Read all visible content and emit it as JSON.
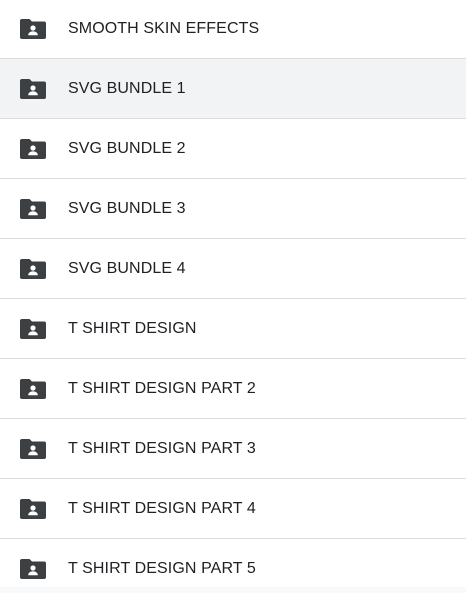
{
  "folders": [
    {
      "name": "SMOOTH SKIN EFFECTS",
      "icon": "shared-folder-icon",
      "selected": false
    },
    {
      "name": "SVG BUNDLE 1",
      "icon": "shared-folder-icon",
      "selected": true
    },
    {
      "name": "SVG BUNDLE 2",
      "icon": "shared-folder-icon",
      "selected": false
    },
    {
      "name": "SVG BUNDLE 3",
      "icon": "shared-folder-icon",
      "selected": false
    },
    {
      "name": "SVG BUNDLE 4",
      "icon": "shared-folder-icon",
      "selected": false
    },
    {
      "name": "T SHIRT DESIGN",
      "icon": "shared-folder-icon",
      "selected": false
    },
    {
      "name": "T SHIRT DESIGN PART 2",
      "icon": "shared-folder-icon",
      "selected": false
    },
    {
      "name": "T SHIRT DESIGN PART 3",
      "icon": "shared-folder-icon",
      "selected": false
    },
    {
      "name": "T SHIRT DESIGN PART 4",
      "icon": "shared-folder-icon",
      "selected": false
    },
    {
      "name": "T SHIRT DESIGN PART 5",
      "icon": "shared-folder-icon",
      "selected": false
    }
  ],
  "colors": {
    "icon": "#3c4043",
    "text": "#202124",
    "divider": "#dadce0",
    "selected_row": "#f1f3f4"
  }
}
